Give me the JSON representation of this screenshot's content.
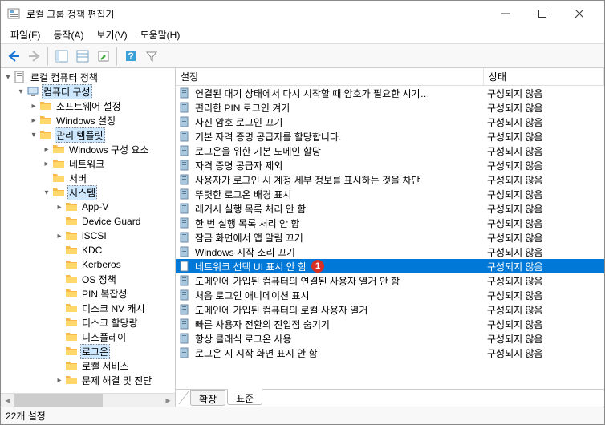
{
  "window": {
    "title": "로컬 그룹 정책 편집기"
  },
  "menu": {
    "file": "파일(F)",
    "action": "동작(A)",
    "view": "보기(V)",
    "help": "도움말(H)"
  },
  "tree": {
    "root": "로컬 컴퓨터 정책",
    "computer_config": "컴퓨터 구성",
    "software_settings": "소프트웨어 설정",
    "windows_settings": "Windows 설정",
    "admin_templates": "관리 템플릿",
    "windows_components": "Windows 구성 요소",
    "network": "네트워크",
    "server": "서버",
    "system": "시스템",
    "appv": "App-V",
    "device_guard": "Device Guard",
    "iscsi": "iSCSI",
    "kdc": "KDC",
    "kerberos": "Kerberos",
    "os_policy": "OS 정책",
    "pin": "PIN 복잡성",
    "disk_nv": "디스크 NV 캐시",
    "disk_quota": "디스크 할당량",
    "display": "디스플레이",
    "logon": "로그온",
    "local_services": "로캘 서비스",
    "troubleshoot": "문제 해결 및 진단"
  },
  "columns": {
    "setting": "설정",
    "state": "상태"
  },
  "state_not_configured": "구성되지 않음",
  "settings": [
    "연결된 대기 상태에서 다시 시작할 때 암호가 필요한 시기…",
    "편리한 PIN 로그인 켜기",
    "사진 암호 로그인 끄기",
    "기본 자격 증명 공급자를 할당합니다.",
    "로그온을 위한 기본 도메인 할당",
    "자격 증명 공급자 제외",
    "사용자가 로그인 시 계정 세부 정보를 표시하는 것을 차단",
    "뚜렷한 로그온 배경 표시",
    "레거시 실행 목록 처리 안 함",
    "한 번 실행 목록 처리 안 함",
    "잠금 화면에서 앱 알림 끄기",
    "Windows 시작 소리 끄기",
    "네트워크 선택 UI 표시 안 함",
    "도메인에 가입된 컴퓨터의 연결된 사용자 열거 안 함",
    "처음 로그인 애니메이션 표시",
    "도메인에 가입된 컴퓨터의 로컬 사용자 열거",
    "빠른 사용자 전환의 진입점 숨기기",
    "항상 클래식 로그온 사용",
    "로그온 시 시작 화면 표시 안 함"
  ],
  "selected_index": 12,
  "callout": "1",
  "tabs": {
    "extended": "확장",
    "standard": "표준"
  },
  "status": "22개 설정"
}
